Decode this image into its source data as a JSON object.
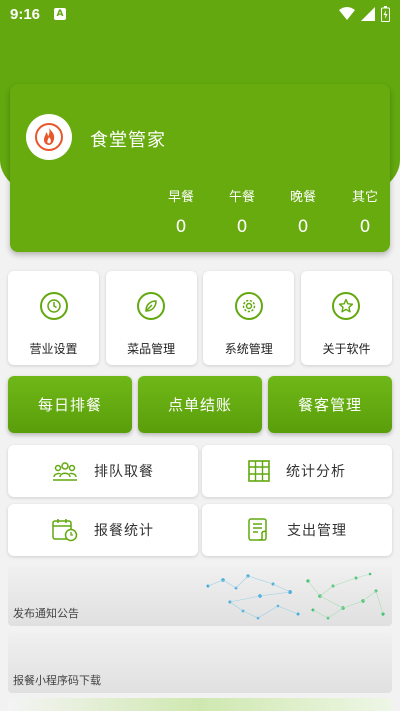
{
  "status": {
    "time": "9:16",
    "notif": "A"
  },
  "app": {
    "title": "食堂管家"
  },
  "meals": [
    {
      "label": "早餐",
      "value": "0"
    },
    {
      "label": "午餐",
      "value": "0"
    },
    {
      "label": "晚餐",
      "value": "0"
    },
    {
      "label": "其它",
      "value": "0"
    }
  ],
  "grid": [
    {
      "label": "营业设置",
      "icon": "clock-icon"
    },
    {
      "label": "菜品管理",
      "icon": "leaf-icon"
    },
    {
      "label": "系统管理",
      "icon": "gear-icon"
    },
    {
      "label": "关于软件",
      "icon": "star-icon"
    }
  ],
  "green_buttons": [
    "每日排餐",
    "点单结账",
    "餐客管理"
  ],
  "white_buttons": [
    {
      "label": "排队取餐",
      "icon": "queue-people-icon"
    },
    {
      "label": "统计分析",
      "icon": "table-grid-icon"
    },
    {
      "label": "报餐统计",
      "icon": "calendar-clock-icon"
    },
    {
      "label": "支出管理",
      "icon": "bill-icon"
    }
  ],
  "banners": [
    "发布通知公告",
    "报餐小程序码下载"
  ],
  "colors": {
    "accent": "#62a80e",
    "card": "#67ab0f"
  }
}
